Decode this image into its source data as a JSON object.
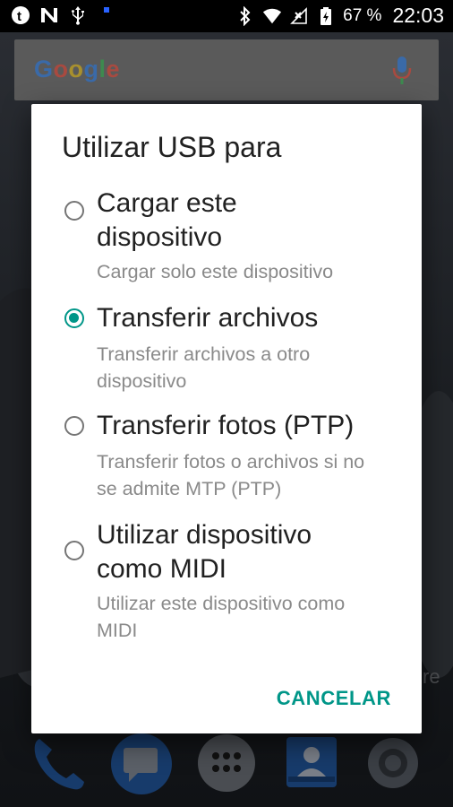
{
  "status_bar": {
    "left_icons": [
      "tumblr-icon",
      "n-notification-icon",
      "usb-icon",
      "notification-dot-icon"
    ],
    "right_icons": [
      "bluetooth-icon",
      "wifi-icon",
      "no-signal-icon",
      "battery-icon"
    ],
    "battery": "67 %",
    "time": "22:03"
  },
  "home": {
    "search_logo": [
      "G",
      "o",
      "o",
      "g",
      "l",
      "e"
    ],
    "search_logo_colors": [
      "#4285F4",
      "#EA4335",
      "#FBBC05",
      "#4285F4",
      "#34A853",
      "#EA4335"
    ],
    "bg_text_left": "W",
    "bg_text_right": "re",
    "dock_icons": [
      "phone-icon",
      "messages-icon",
      "apps-drawer-icon",
      "contacts-icon",
      "settings-icon"
    ]
  },
  "dialog": {
    "title": "Utilizar USB para",
    "options": [
      {
        "label_lines": [
          "Cargar este",
          "dispositivo"
        ],
        "desc_lines": [
          "Cargar solo este dispositivo"
        ],
        "selected": false
      },
      {
        "label_lines": [
          "Transferir archivos"
        ],
        "desc_lines": [
          "Transferir archivos a otro",
          "dispositivo"
        ],
        "selected": true
      },
      {
        "label_lines": [
          "Transferir fotos (PTP)"
        ],
        "desc_lines": [
          "Transferir fotos o archivos si no",
          "se admite MTP (PTP)"
        ],
        "selected": false
      },
      {
        "label_lines": [
          "Utilizar dispositivo",
          "como MIDI"
        ],
        "desc_lines": [
          "Utilizar este dispositivo como",
          "MIDI"
        ],
        "selected": false
      }
    ],
    "cancel_label": "CANCELAR"
  },
  "colors": {
    "accent": "#009688",
    "title_text": "#212121",
    "secondary_text": "#8a8a8a"
  }
}
